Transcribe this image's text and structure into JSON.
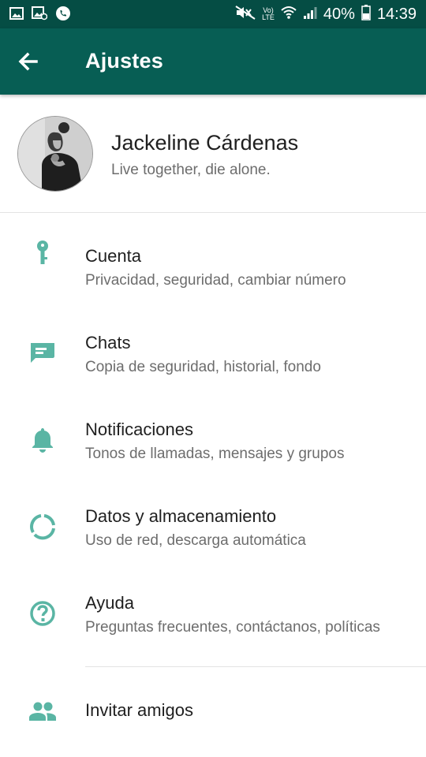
{
  "status_bar": {
    "volte_top": "Vo)",
    "volte_bottom": "LTE",
    "battery": "40%",
    "time": "14:39"
  },
  "app_bar": {
    "title": "Ajustes"
  },
  "profile": {
    "name": "Jackeline Cárdenas",
    "status": "Live together, die alone."
  },
  "menu": [
    {
      "title": "Cuenta",
      "subtitle": "Privacidad, seguridad, cambiar número",
      "icon": "key-icon"
    },
    {
      "title": "Chats",
      "subtitle": "Copia de seguridad, historial, fondo",
      "icon": "chat-icon"
    },
    {
      "title": "Notificaciones",
      "subtitle": "Tonos de llamadas, mensajes y grupos",
      "icon": "bell-icon"
    },
    {
      "title": "Datos y almacenamiento",
      "subtitle": "Uso de red, descarga automática",
      "icon": "data-usage-icon"
    },
    {
      "title": "Ayuda",
      "subtitle": "Preguntas frecuentes, contáctanos, políticas",
      "icon": "help-icon"
    },
    {
      "title": "Invitar amigos",
      "icon": "people-icon"
    }
  ],
  "colors": {
    "status_bar": "#054d44",
    "app_bar": "#075e54",
    "icon_accent": "#5ab5a4"
  }
}
